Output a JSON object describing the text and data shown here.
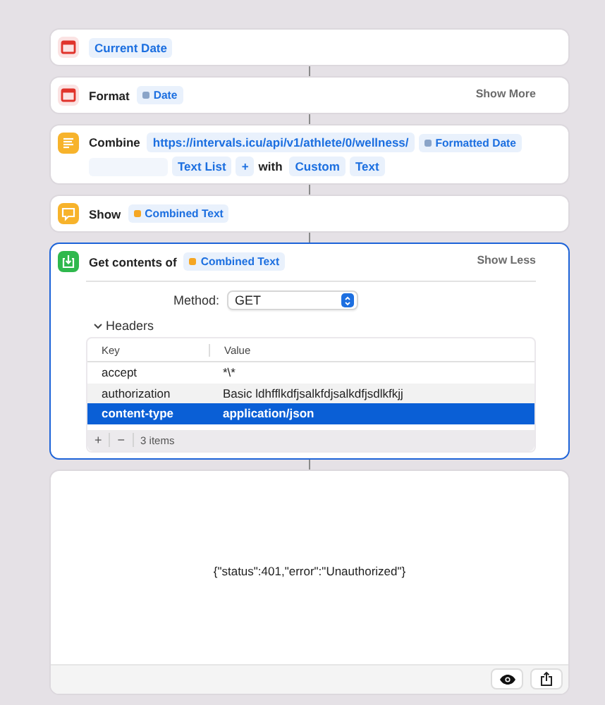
{
  "actions": [
    {
      "kind": "calendar",
      "expanded": false,
      "parts": [
        {
          "kind": "token",
          "text": "Current Date"
        }
      ]
    },
    {
      "kind": "calendar",
      "expanded": false,
      "toggle": "Show More",
      "parts": [
        {
          "kind": "label",
          "text": "Format"
        },
        {
          "kind": "variable",
          "text": "Date",
          "color": "#8aa4c8"
        }
      ]
    },
    {
      "kind": "text",
      "expanded": false,
      "parts": [
        {
          "kind": "label",
          "text": "Combine"
        },
        {
          "kind": "token",
          "text": "https://intervals.icu/api/v1/athlete/0/wellness/"
        },
        {
          "kind": "variable",
          "text": "Formatted Date",
          "color": "#8aa4c8"
        },
        {
          "kind": "empty"
        },
        {
          "kind": "token",
          "text": "Text List"
        },
        {
          "kind": "plus",
          "text": "+"
        },
        {
          "kind": "label",
          "text": "with"
        },
        {
          "kind": "token",
          "text": "Custom"
        },
        {
          "kind": "token",
          "text": "Text"
        }
      ]
    },
    {
      "kind": "show",
      "expanded": false,
      "parts": [
        {
          "kind": "label",
          "text": "Show"
        },
        {
          "kind": "variable",
          "text": "Combined Text",
          "color": "#f5a623"
        }
      ]
    },
    {
      "kind": "download",
      "expanded": true,
      "toggle": "Show Less",
      "parts": [
        {
          "kind": "label",
          "text": "Get contents of"
        },
        {
          "kind": "variable",
          "text": "Combined Text",
          "color": "#f5a623"
        }
      ],
      "method": {
        "label": "Method:",
        "value": "GET"
      },
      "headers": {
        "label": "Headers",
        "columns": [
          "Key",
          "Value"
        ],
        "rows": [
          {
            "key": "accept",
            "value": "*\\*",
            "selected": false
          },
          {
            "key": "authorization",
            "value": "Basic ldhfflkdfjsalkfdjsalkdfjsdlkfkjj",
            "selected": false
          },
          {
            "key": "content-type",
            "value": "application/json",
            "selected": true
          }
        ],
        "add": "+",
        "remove": "−",
        "count": "3 items"
      }
    }
  ],
  "result": {
    "text": "{\"status\":401,\"error\":\"Unauthorized\"}"
  }
}
